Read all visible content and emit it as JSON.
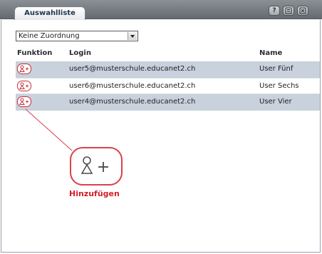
{
  "window": {
    "tab_label": "Auswahlliste",
    "controls": [
      {
        "name": "help",
        "glyph": "?"
      },
      {
        "name": "print",
        "glyph": ""
      },
      {
        "name": "close",
        "glyph": ""
      }
    ]
  },
  "filter": {
    "selected": "Keine Zuordnung"
  },
  "table": {
    "headers": {
      "funktion": "Funktion",
      "login": "Login",
      "name": "Name"
    },
    "rows": [
      {
        "login": "user5@musterschule.educanet2.ch",
        "name": "User Fünf"
      },
      {
        "login": "user6@musterschule.educanet2.ch",
        "name": "User Sechs"
      },
      {
        "login": "user4@musterschule.educanet2.ch",
        "name": "User Vier"
      }
    ]
  },
  "callout": {
    "label": "Hinzufügen"
  },
  "icons": {
    "add_user": "add-user-icon"
  },
  "colors": {
    "accent_red": "#d21e2a",
    "row_shade": "#c8d1dc",
    "titlebar": "#6f757b"
  }
}
